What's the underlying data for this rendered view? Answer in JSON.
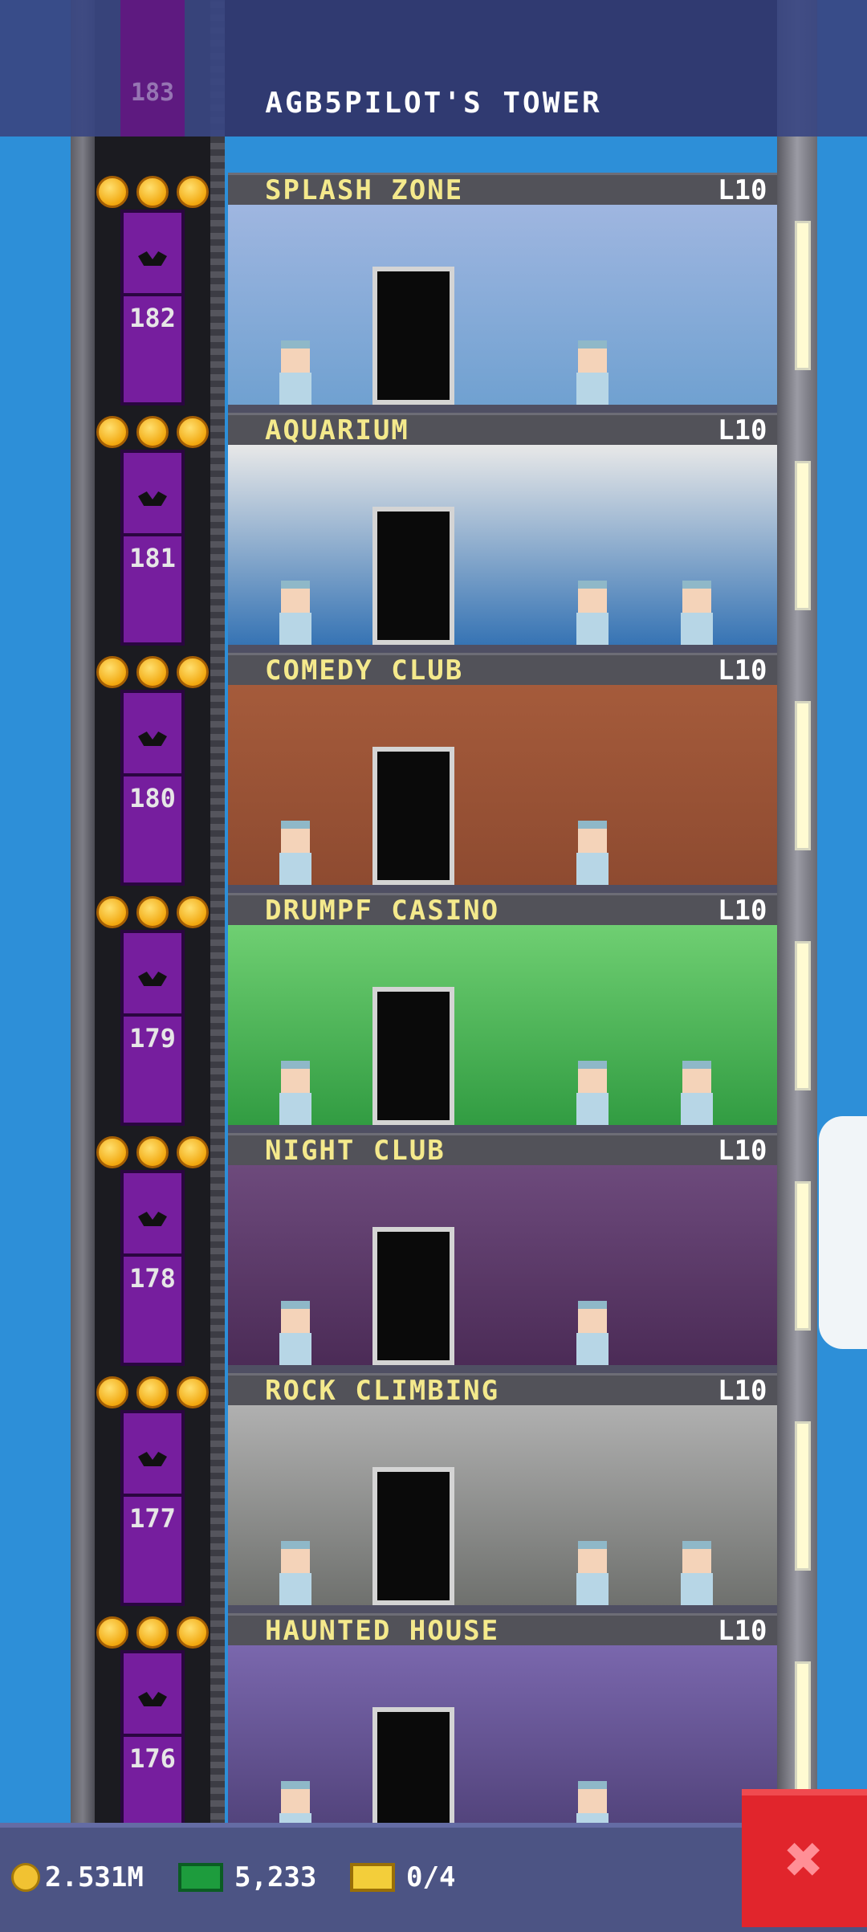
{
  "header": {
    "title": "AGB5PILOT'S TOWER",
    "top_floor_number": "183"
  },
  "floors": [
    {
      "name": "SPLASH ZONE",
      "level": "L10",
      "number": "182",
      "stars": 3,
      "room_color": "#6ea0d0",
      "wall_color": "#9fb6e0"
    },
    {
      "name": "AQUARIUM",
      "level": "L10",
      "number": "181",
      "stars": 3,
      "room_color": "#2f6fb2",
      "wall_color": "#e8e8e8"
    },
    {
      "name": "COMEDY CLUB",
      "level": "L10",
      "number": "180",
      "stars": 3,
      "room_color": "#8d4a30",
      "wall_color": "#a55b3b"
    },
    {
      "name": "DRUMPF CASINO",
      "level": "L10",
      "number": "179",
      "stars": 3,
      "room_color": "#2f9a40",
      "wall_color": "#6fcf72"
    },
    {
      "name": "NIGHT CLUB",
      "level": "L10",
      "number": "178",
      "stars": 3,
      "room_color": "#4a2a55",
      "wall_color": "#6d4a7c"
    },
    {
      "name": "ROCK CLIMBING",
      "level": "L10",
      "number": "177",
      "stars": 3,
      "room_color": "#6c6e6b",
      "wall_color": "#b0b0b0"
    },
    {
      "name": "HAUNTED HOUSE",
      "level": "L10",
      "number": "176",
      "stars": 3,
      "room_color": "#4c3e74",
      "wall_color": "#7a67ad"
    }
  ],
  "footer": {
    "coins": "2.531M",
    "bux": "5,233",
    "tickets": "0/4"
  },
  "icons": {
    "coin": "coin-icon",
    "bux": "bux-icon",
    "ticket": "ticket-icon",
    "close": "close-icon"
  }
}
